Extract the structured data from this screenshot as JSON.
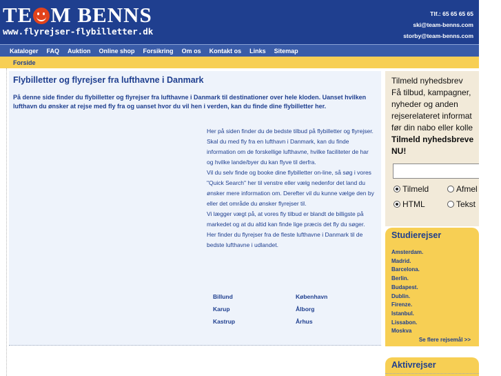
{
  "header": {
    "logo_text_left": "TE",
    "logo_text_right": "M BENNS",
    "logo_url": "www.flyrejser-flybilletter.dk",
    "phone": "Tlf.: 65 65 65 65",
    "email_1": "ski@team-benns.com",
    "email_2": "storby@team-benns.com"
  },
  "nav": {
    "items": [
      "Kataloger",
      "FAQ",
      "Auktion",
      "Online shop",
      "Forsikring",
      "Om os",
      "Kontakt os",
      "Links",
      "Sitemap"
    ]
  },
  "breadcrumb": {
    "home": "Forside"
  },
  "main": {
    "title": "Flybilletter og flyrejser fra lufthavne i Danmark",
    "intro": "På denne side finder du flybilletter og flyrejser fra lufthavne i Danmark til destinationer over hele kloden. Uanset hvilken lufthavn du ønsker at rejse med fly fra og uanset hvor du vil hen i verden, kan du finde dine flybilletter her.",
    "para_1": "Her på siden finder du de bedste tilbud på flybilletter og flyrejser. Skal du med fly fra en lufthavn i Danmark, kan du finde information om de forskellige lufthavne, hvilke faciliteter de har og hvilke lande/byer du kan flyve til derfra.",
    "para_2": "Vil du selv finde og booke dine flybilletter on-line, så søg i vores \"Quick Search\" her til venstre eller vælg nedenfor det land du ønsker mere information om. Derefter vil du kunne vælge den by eller det område du ønsker flyrejser til.",
    "para_3": "Vi lægger vægt på, at vores fly tilbud er blandt de billigste på markedet og at du altid kan finde lige præcis det fly du søger. Her finder du flyrejser fra de fleste lufthavne i Danmark til de bedste lufthavne i udlandet.",
    "airports": [
      "Billund",
      "København",
      "Karup",
      "Ålborg",
      "Kastrup",
      "Århus"
    ]
  },
  "newsletter": {
    "line_1": "Tilmeld nyhedsbrev",
    "line_2": "Få tilbud, kampagner,",
    "line_3": "nyheder og anden",
    "line_4": "rejserelateret informat",
    "line_5": "før din nabo eller kolle",
    "line_6": "Tilmeld nyhedsbreve",
    "line_7": "NU!",
    "email_value": "",
    "radio_subscribe": "Tilmeld",
    "radio_unsubscribe": "Afmel",
    "radio_html": "HTML",
    "radio_text": "Tekst"
  },
  "studierejser": {
    "title": "Studierejser",
    "destinations": [
      "Amsterdam.",
      "Madrid.",
      "Barcelona.",
      "Berlin.",
      "Budapest.",
      "Dublin.",
      "Firenze.",
      "Istanbul.",
      "Lissabon.",
      "Moskva"
    ],
    "see_more": "Se flere rejsemål >>"
  },
  "aktivrejser": {
    "title": "Aktivrejser"
  },
  "colors": {
    "header_blue": "#1f3f8f",
    "nav_blue": "#3a5ca8",
    "accent_yellow": "#f7cf54",
    "content_bg": "#eef3fb",
    "newsletter_bg": "#f2ead9",
    "logo_red": "#e2431b"
  }
}
